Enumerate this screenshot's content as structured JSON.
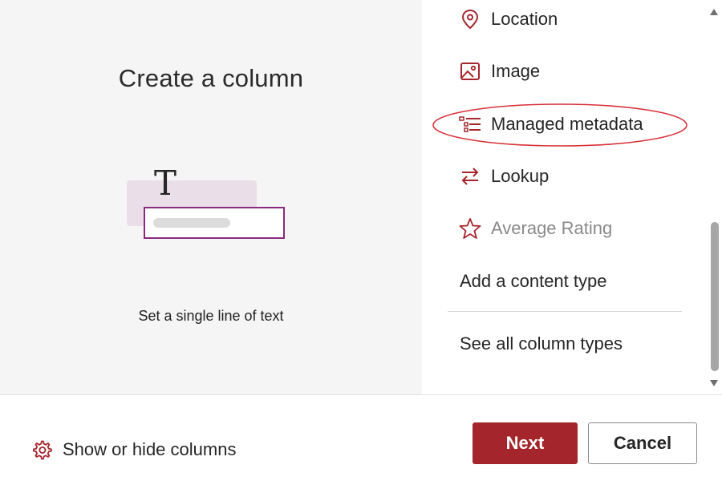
{
  "preview": {
    "title": "Create a column",
    "description": "Set a single line of text"
  },
  "column_types": [
    {
      "label": "Location",
      "icon": "location-pin-icon",
      "disabled": false
    },
    {
      "label": "Image",
      "icon": "image-icon",
      "disabled": false
    },
    {
      "label": "Managed metadata",
      "icon": "managed-metadata-icon",
      "disabled": false,
      "highlighted": true
    },
    {
      "label": "Lookup",
      "icon": "lookup-arrows-icon",
      "disabled": false
    },
    {
      "label": "Average Rating",
      "icon": "star-icon",
      "disabled": true
    }
  ],
  "add_content_type": "Add a content type",
  "see_all": "See all column types",
  "footer": {
    "show_hide_label": "Show or hide columns",
    "show_hide_icon": "gear-icon",
    "next_label": "Next",
    "cancel_label": "Cancel"
  },
  "colors": {
    "accent": "#a4262c",
    "highlight_ring": "#d9303a",
    "illustration_fill": "#eadfe8",
    "illustration_border": "#8a2a7e"
  }
}
